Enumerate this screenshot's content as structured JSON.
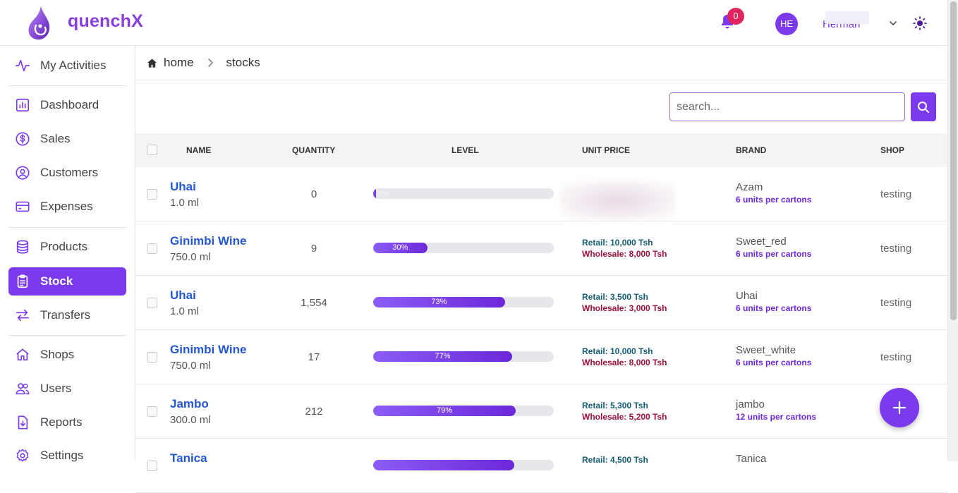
{
  "app": {
    "brand": "quenchX"
  },
  "header": {
    "notification_count": "0",
    "avatar_initials": "HE",
    "username": "Herman",
    "accent_color": "#7c3aed",
    "badge_color": "#e0245e"
  },
  "sidebar": {
    "items": [
      {
        "label": "My Activities",
        "icon": "activity-icon"
      },
      {
        "label": "Dashboard",
        "icon": "dashboard-icon"
      },
      {
        "label": "Sales",
        "icon": "dollar-icon"
      },
      {
        "label": "Customers",
        "icon": "user-circle-icon"
      },
      {
        "label": "Expenses",
        "icon": "credit-card-icon"
      },
      {
        "label": "Products",
        "icon": "database-icon"
      },
      {
        "label": "Stock",
        "icon": "clipboard-icon",
        "active": true
      },
      {
        "label": "Transfers",
        "icon": "transfer-arrows-icon"
      },
      {
        "label": "Shops",
        "icon": "home-icon"
      },
      {
        "label": "Users",
        "icon": "users-icon"
      },
      {
        "label": "Reports",
        "icon": "download-file-icon"
      },
      {
        "label": "Settings",
        "icon": "gear-icon"
      }
    ]
  },
  "breadcrumb": {
    "home": "home",
    "current": "stocks"
  },
  "search": {
    "placeholder": "search..."
  },
  "table": {
    "headers": {
      "name": "NAME",
      "quantity": "QUANTITY",
      "level": "LEVEL",
      "unit_price": "UNIT PRICE",
      "brand": "BRAND",
      "shop": "SHOP"
    },
    "rows": [
      {
        "name": "Uhai",
        "size": "1.0 ml",
        "quantity": "0",
        "level": 0,
        "level_label": "0%",
        "retail": "",
        "wholesale": "",
        "brand": "Azam",
        "units": "6 units per cartons",
        "shop": "testing",
        "price_blurred": true
      },
      {
        "name": "Ginimbi Wine",
        "size": "750.0 ml",
        "quantity": "9",
        "level": 30,
        "level_label": "30%",
        "retail": "Retail: 10,000 Tsh",
        "wholesale": "Wholesale: 8,000 Tsh",
        "brand": "Sweet_red",
        "units": "6 units per cartons",
        "shop": "testing"
      },
      {
        "name": "Uhai",
        "size": "1.0 ml",
        "quantity": "1,554",
        "level": 73,
        "level_label": "73%",
        "retail": "Retail: 3,500 Tsh",
        "wholesale": "Wholesale: 3,000 Tsh",
        "brand": "Uhai",
        "units": "6 units per cartons",
        "shop": "testing"
      },
      {
        "name": "Ginimbi Wine",
        "size": "750.0 ml",
        "quantity": "17",
        "level": 77,
        "level_label": "77%",
        "retail": "Retail: 10,000 Tsh",
        "wholesale": "Wholesale: 8,000 Tsh",
        "brand": "Sweet_white",
        "units": "6 units per cartons",
        "shop": "testing"
      },
      {
        "name": "Jambo",
        "size": "300.0 ml",
        "quantity": "212",
        "level": 79,
        "level_label": "79%",
        "retail": "Retail: 5,300 Tsh",
        "wholesale": "Wholesale: 5,200 Tsh",
        "brand": "jambo",
        "units": "12 units per cartons",
        "shop": ""
      },
      {
        "name": "Tanica",
        "size": "",
        "quantity": "",
        "level": 78,
        "level_label": "",
        "retail": "Retail: 4,500 Tsh",
        "wholesale": "",
        "brand": "Tanica",
        "units": "",
        "shop": ""
      }
    ]
  }
}
